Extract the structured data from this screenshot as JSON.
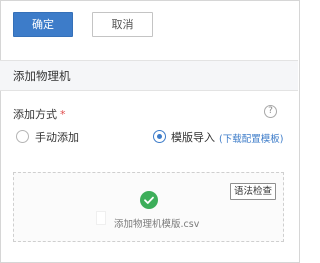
{
  "toolbar": {
    "confirm_label": "确定",
    "cancel_label": "取消"
  },
  "section": {
    "title": "添加物理机"
  },
  "form": {
    "add_method_label": "添加方式",
    "required_mark": "*",
    "help_icon": "question-icon",
    "options": [
      {
        "label": "手动添加",
        "selected": false
      },
      {
        "label": "模版导入",
        "selected": true
      }
    ],
    "download_template_link": "(下载配置模板)"
  },
  "upload": {
    "status_icon": "check-circle-icon",
    "file_icon": "file-icon",
    "file_name": "添加物理机模版.csv",
    "syntax_check_label": "语法检查"
  },
  "colors": {
    "primary": "#3d7cc9",
    "success": "#3dae5a"
  }
}
